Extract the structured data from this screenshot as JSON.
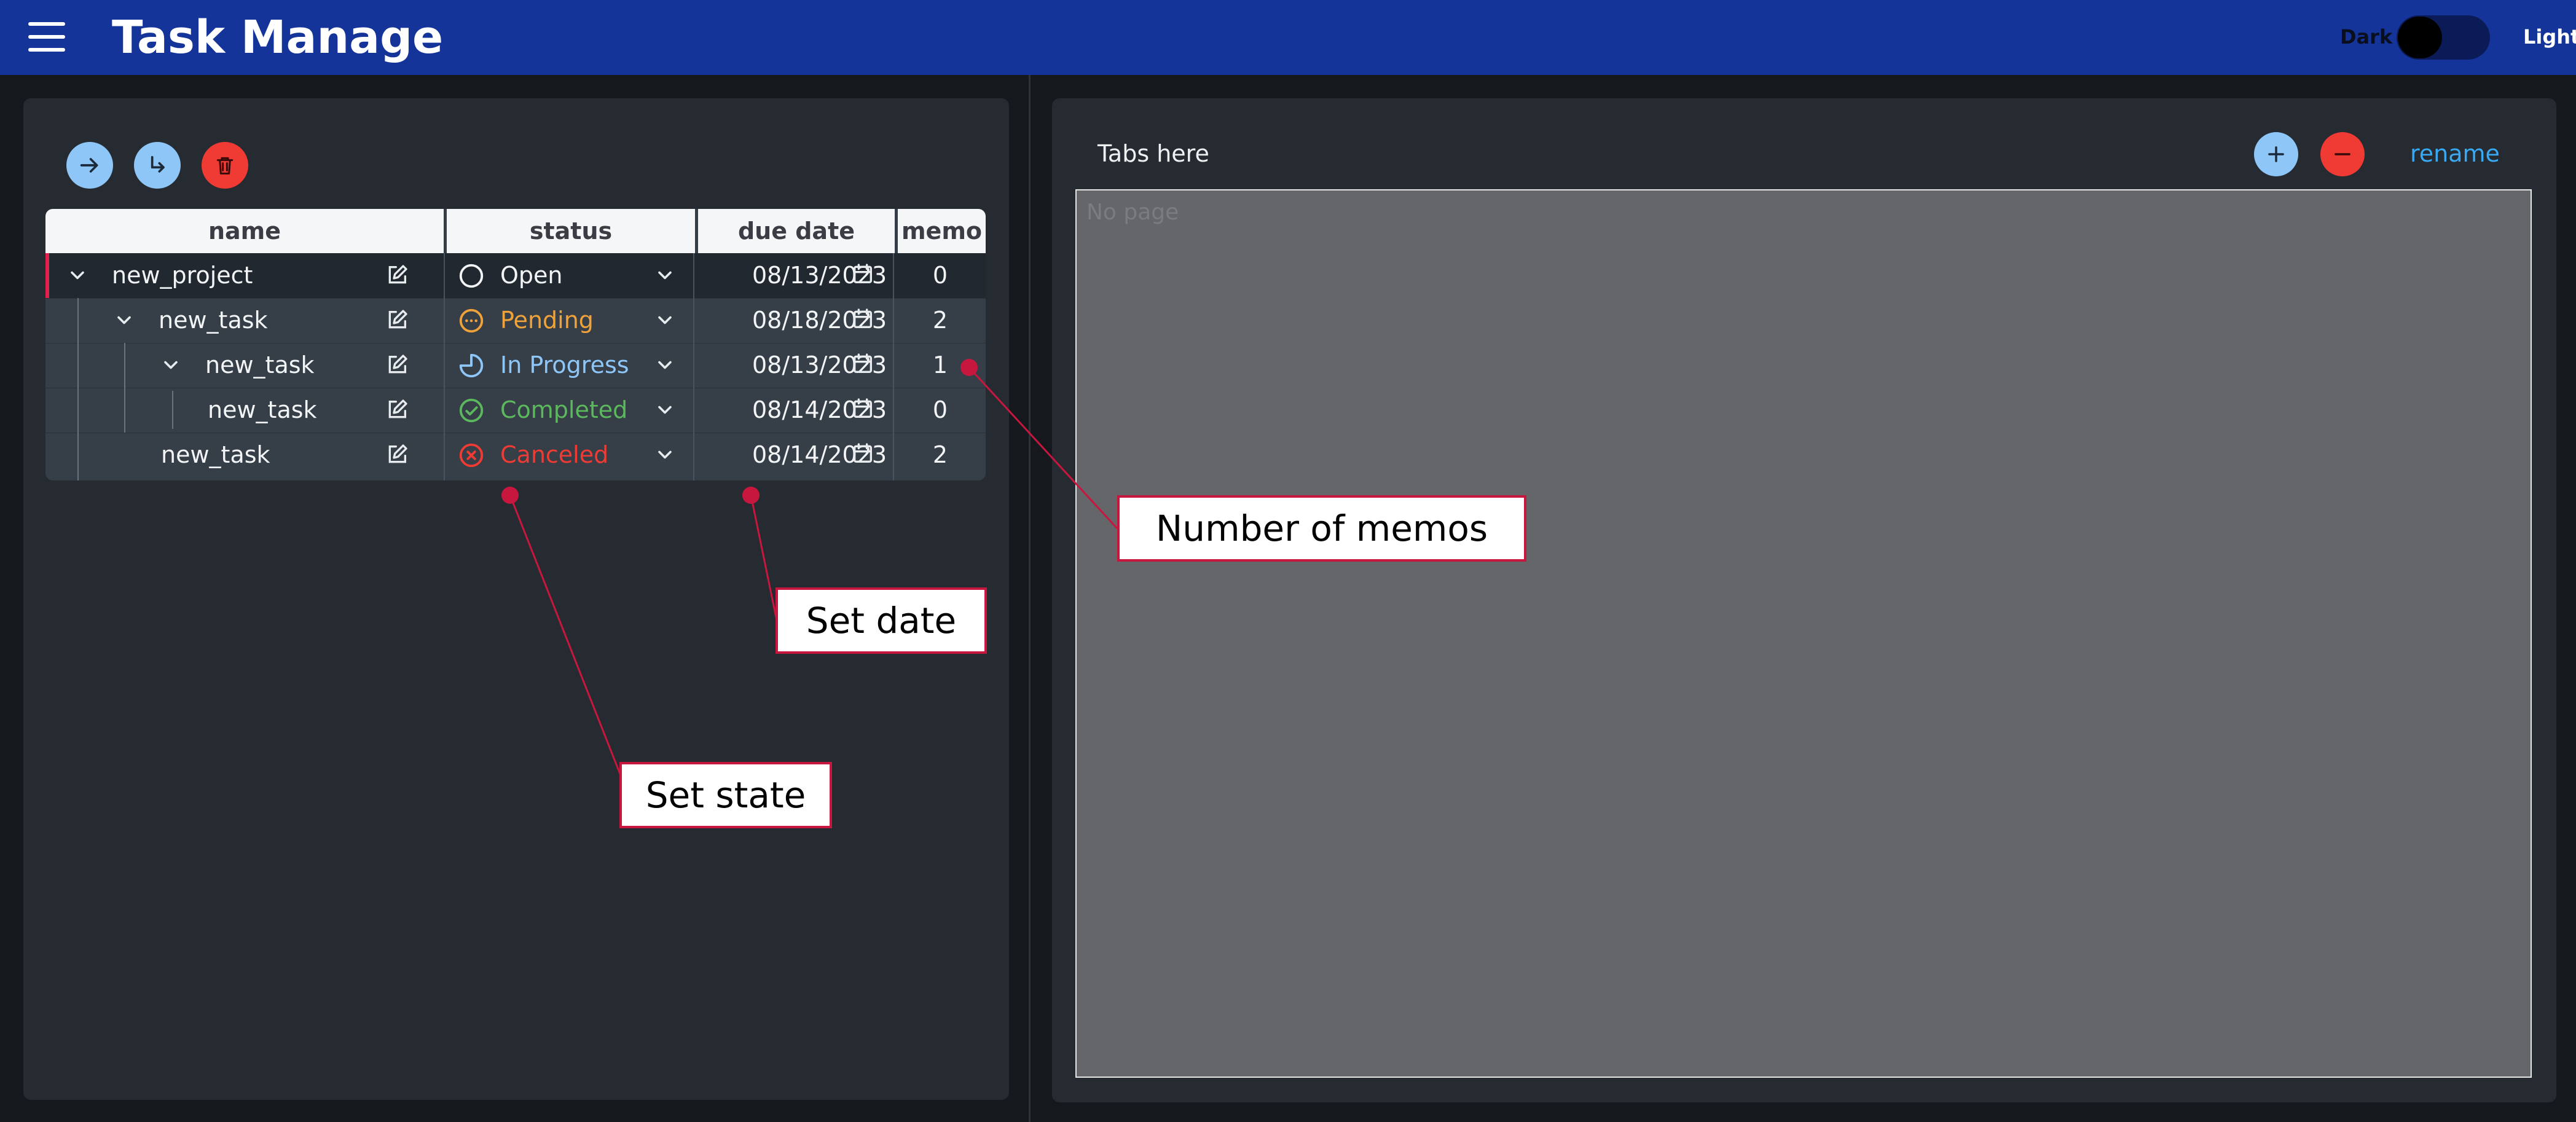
{
  "app": {
    "title": "Task Manage",
    "theme_toggle": {
      "left_label": "Dark",
      "right_label": "Light"
    }
  },
  "toolbar": {
    "buttons": [
      {
        "name": "arrow-right-icon",
        "color": "#8ec6f8"
      },
      {
        "name": "subdirectory-arrow-icon",
        "color": "#8ec6f8"
      },
      {
        "name": "trash-icon",
        "color": "#ef3b33"
      }
    ]
  },
  "table": {
    "columns": [
      "name",
      "status",
      "due date",
      "memo"
    ],
    "rows": [
      {
        "name": "new_project",
        "depth": 0,
        "expanded": true,
        "status": "Open",
        "status_color": "#f2f4f6",
        "due_date": "08/13/2023",
        "memo": "0"
      },
      {
        "name": "new_task",
        "depth": 1,
        "expanded": true,
        "status": "Pending",
        "status_color": "#f0a23a",
        "due_date": "08/18/2023",
        "memo": "2"
      },
      {
        "name": "new_task",
        "depth": 2,
        "expanded": true,
        "status": "In Progress",
        "status_color": "#8ec6f8",
        "due_date": "08/13/2023",
        "memo": "1"
      },
      {
        "name": "new_task",
        "depth": 3,
        "expanded": false,
        "status": "Completed",
        "status_color": "#5cb85c",
        "due_date": "08/14/2023",
        "memo": "0"
      },
      {
        "name": "new_task",
        "depth": 1,
        "expanded": false,
        "status": "Canceled",
        "status_color": "#ef3b33",
        "due_date": "08/14/2023",
        "memo": "2"
      }
    ]
  },
  "pages": {
    "tabs_label": "Tabs here",
    "rename_label": "rename",
    "empty_text": "No page"
  },
  "annotations": {
    "memos": "Number of memos",
    "date": "Set date",
    "state": "Set state"
  },
  "colors": {
    "appbar": "#14349a",
    "accent_red": "#c8173f",
    "link": "#38a9f2"
  }
}
